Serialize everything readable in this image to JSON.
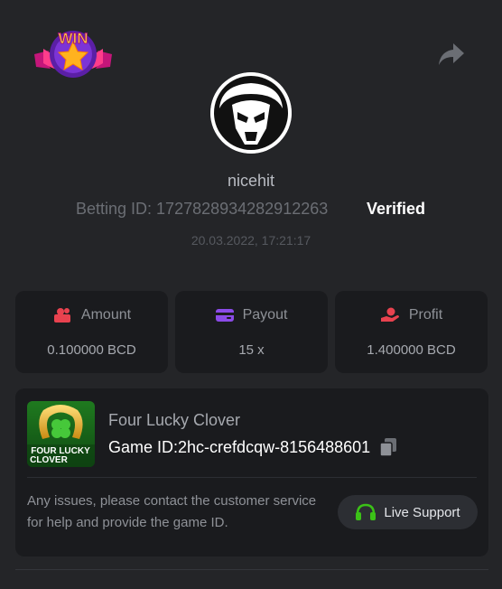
{
  "header": {
    "badge_text": "WIN",
    "share_icon": "share-arrow-icon"
  },
  "profile": {
    "username": "nicehit",
    "betting_id": "Betting ID: 1727828934282912263",
    "status": "Verified",
    "timestamp": "20.03.2022, 17:21:17"
  },
  "stats": [
    {
      "label": "Amount",
      "value": "0.100000 BCD",
      "icon": "coins-icon",
      "icon_color": "#e8424f"
    },
    {
      "label": "Payout",
      "value": "15 x",
      "icon": "card-icon",
      "icon_color": "#8b4be8"
    },
    {
      "label": "Profit",
      "value": "1.400000 BCD",
      "icon": "hand-coin-icon",
      "icon_color": "#e8424f"
    }
  ],
  "game": {
    "name": "Four Lucky Clover",
    "id_label": "Game ID:",
    "id_value": "2hc-crefdcqw-8156488601",
    "thumb_text_line1": "FOUR LUCKY",
    "thumb_text_line2": "CLOVER",
    "copy_icon": "copy-icon"
  },
  "support": {
    "notice": "Any issues, please contact the customer service for help and provide the game ID.",
    "button_label": "Live Support",
    "icon": "headset-icon",
    "icon_color": "#3bc117"
  },
  "colors": {
    "background": "#242528",
    "card": "#1a1b1e",
    "accent_green": "#3bc117"
  }
}
